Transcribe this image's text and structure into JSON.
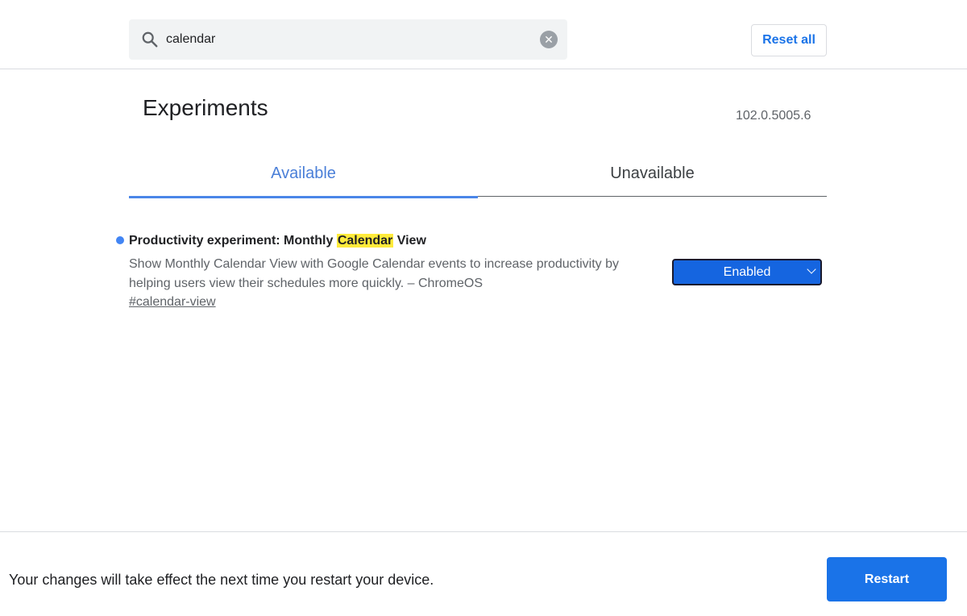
{
  "search": {
    "value": "calendar"
  },
  "header": {
    "reset_label": "Reset all"
  },
  "title": "Experiments",
  "version": "102.0.5005.6",
  "tabs": [
    {
      "label": "Available",
      "active": true
    },
    {
      "label": "Unavailable",
      "active": false
    }
  ],
  "experiment": {
    "title_before": "Productivity experiment: Monthly ",
    "title_highlight": "Calendar",
    "title_after": " View",
    "description": "Show Monthly Calendar View with Google Calendar events to increase productivity by helping users view their schedules more quickly. – ChromeOS",
    "link": "#calendar-view",
    "selected_option": "Enabled"
  },
  "footer": {
    "message": "Your changes will take effect the next time you restart your device.",
    "restart_label": "Restart"
  },
  "colors": {
    "accent": "#1a73e8",
    "highlight": "#ffeb3b",
    "select_bg": "#1565e0"
  }
}
